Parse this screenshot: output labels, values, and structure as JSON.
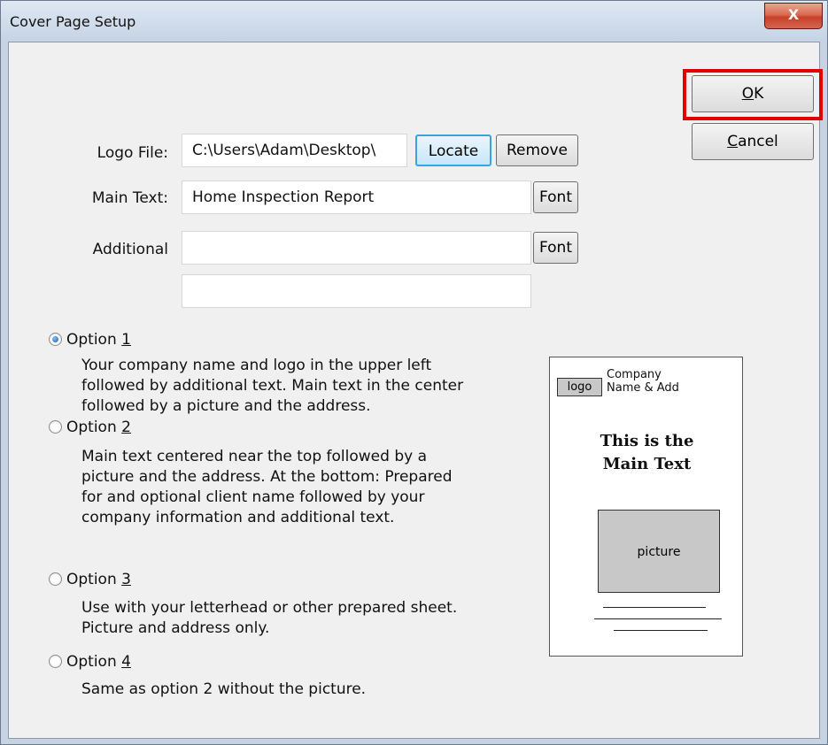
{
  "window": {
    "title": "Cover Page Setup",
    "close_label": "X"
  },
  "buttons": {
    "ok": {
      "accel": "O",
      "rest": "K"
    },
    "cancel": {
      "accel": "C",
      "rest": "ancel"
    },
    "locate": "Locate",
    "remove": "Remove",
    "font": "Font"
  },
  "fields": {
    "logo_file": {
      "label": "Logo File:",
      "value": "C:\\Users\\Adam\\Desktop\\"
    },
    "main_text": {
      "label": "Main Text:",
      "value": "Home Inspection Report"
    },
    "additional": {
      "label": "Additional",
      "value": "",
      "value2": ""
    }
  },
  "options": [
    {
      "prefix": "Option ",
      "number": "1",
      "selected": true,
      "lines": [
        "Your company name and logo in the upper left",
        "followed by additional text. Main text in the center",
        "followed by a picture and the address."
      ]
    },
    {
      "prefix": "Option ",
      "number": "2",
      "selected": false,
      "lines": [
        "Main text centered near the top followed by a",
        "picture and the address. At the bottom: Prepared",
        "for and optional client name followed by your",
        "company information and additional text."
      ]
    },
    {
      "prefix": "Option ",
      "number": "3",
      "selected": false,
      "lines": [
        "Use with your letterhead or other prepared sheet.",
        "Picture and address only."
      ]
    },
    {
      "prefix": "Option ",
      "number": "4",
      "selected": false,
      "lines": [
        "Same as option 2 without the picture."
      ]
    }
  ],
  "preview": {
    "logo": "logo",
    "company_line1": "Company",
    "company_line2": "Name & Add",
    "main_line1": "This is the",
    "main_line2": "Main Text",
    "picture": "picture"
  },
  "colors": {
    "ok_highlight": "#e00000",
    "locate_focus": "#39a2df"
  }
}
